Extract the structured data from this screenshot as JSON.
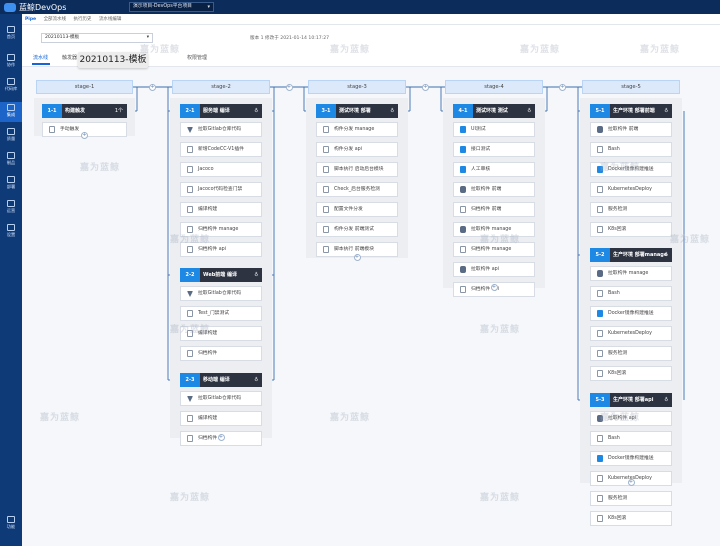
{
  "app": {
    "name": "蓝鲸DevOps",
    "project": "演示项目-DevOps平台项目"
  },
  "sidebar": [
    {
      "label": "首页",
      "icon": "home-icon"
    },
    {
      "label": "协作",
      "icon": "collab-icon"
    },
    {
      "label": "代码库",
      "icon": "code-icon"
    },
    {
      "label": "集成",
      "icon": "integration-icon"
    },
    {
      "label": "质量",
      "icon": "quality-icon"
    },
    {
      "label": "制品",
      "icon": "artifact-icon"
    },
    {
      "label": "部署",
      "icon": "deploy-icon"
    },
    {
      "label": "运营",
      "icon": "ops-icon"
    },
    {
      "label": "设置",
      "icon": "settings-icon"
    },
    {
      "label": "功能",
      "icon": "function-icon"
    }
  ],
  "breadcrumb": [
    "Pipe",
    "全部流水线",
    "执行历史",
    "流水线编辑"
  ],
  "pipeline": {
    "select_value": "20210113-模板",
    "version": "版本 1 修改于 2021-01-14 10:17:27",
    "tooltip": "20210113-模板",
    "tabs": [
      "流水线",
      "触发器",
      "通知设置",
      "权限管理"
    ]
  },
  "stages": [
    {
      "name": "stage-1",
      "jobs": [
        {
          "num": "1-1",
          "name": "构建触发",
          "extra": "1个",
          "tasks": [
            {
              "name": "手动触发",
              "icon": "hand"
            }
          ]
        }
      ]
    },
    {
      "name": "stage-2",
      "jobs": [
        {
          "num": "2-1",
          "name": "服务端 编译",
          "tasks": [
            {
              "name": "拉取Gitlab仓库代码",
              "icon": "tri"
            },
            {
              "name": "新增CodeCC-V1插件",
              "icon": "doc"
            },
            {
              "name": "Jacoco",
              "icon": "doc"
            },
            {
              "name": "Jacoco代码检查门禁",
              "icon": "doc"
            },
            {
              "name": "编译构建",
              "icon": "doc"
            },
            {
              "name": "归档构件 manage",
              "icon": "doc"
            },
            {
              "name": "归档构件 api",
              "icon": "doc"
            }
          ]
        },
        {
          "num": "2-2",
          "name": "Web前端 编译",
          "tasks": [
            {
              "name": "拉取Gitlab仓库代码",
              "icon": "tri"
            },
            {
              "name": "Test_门禁测试",
              "icon": "doc"
            },
            {
              "name": "编译构建",
              "icon": "doc"
            },
            {
              "name": "归档构件",
              "icon": "doc"
            }
          ]
        },
        {
          "num": "2-3",
          "name": "移动端 编译",
          "tasks": [
            {
              "name": "拉取Gitlab仓库代码",
              "icon": "tri"
            },
            {
              "name": "编译构建",
              "icon": "doc"
            },
            {
              "name": "归档构件",
              "icon": "doc"
            }
          ]
        }
      ]
    },
    {
      "name": "stage-3",
      "jobs": [
        {
          "num": "3-1",
          "name": "测试环境 部署",
          "tasks": [
            {
              "name": "构件分发 manage",
              "icon": "doc"
            },
            {
              "name": "构件分发 api",
              "icon": "doc"
            },
            {
              "name": "脚本执行 启动后台模块",
              "icon": "doc"
            },
            {
              "name": "Check_后台服务检测",
              "icon": "doc"
            },
            {
              "name": "配置文件分发",
              "icon": "doc"
            },
            {
              "name": "构件分发 前端测试",
              "icon": "doc"
            },
            {
              "name": "脚本执行 前端模块",
              "icon": "doc"
            }
          ]
        }
      ]
    },
    {
      "name": "stage-4",
      "jobs": [
        {
          "num": "4-1",
          "name": "测试环境 测试",
          "tasks": [
            {
              "name": "UI测试",
              "icon": "img"
            },
            {
              "name": "接口测试",
              "icon": "img"
            },
            {
              "name": "人工审核",
              "icon": "img"
            },
            {
              "name": "拉取构件 前端",
              "icon": "dk"
            },
            {
              "name": "归档构件 前端",
              "icon": "doc"
            },
            {
              "name": "拉取构件 manage",
              "icon": "dk"
            },
            {
              "name": "归档构件 manage",
              "icon": "doc"
            },
            {
              "name": "拉取构件 api",
              "icon": "dk"
            },
            {
              "name": "归档构件 api",
              "icon": "doc"
            }
          ]
        }
      ]
    },
    {
      "name": "stage-5",
      "jobs": [
        {
          "num": "5-1",
          "name": "生产环境 部署前端",
          "tasks": [
            {
              "name": "拉取构件 前端",
              "icon": "dk"
            },
            {
              "name": "Bash",
              "icon": "doc"
            },
            {
              "name": "Docker镜像构建推送",
              "icon": "img"
            },
            {
              "name": "KubernetesDeploy",
              "icon": "doc"
            },
            {
              "name": "服务检测",
              "icon": "doc"
            },
            {
              "name": "K8s回滚",
              "icon": "doc"
            }
          ]
        },
        {
          "num": "5-2",
          "name": "生产环境 部署manage",
          "tasks": [
            {
              "name": "拉取构件 manage",
              "icon": "dk"
            },
            {
              "name": "Bash",
              "icon": "doc"
            },
            {
              "name": "Docker镜像构建推送",
              "icon": "img"
            },
            {
              "name": "KubernetesDeploy",
              "icon": "doc"
            },
            {
              "name": "服务检测",
              "icon": "doc"
            },
            {
              "name": "K8s回滚",
              "icon": "doc"
            }
          ]
        },
        {
          "num": "5-3",
          "name": "生产环境 部署api",
          "tasks": [
            {
              "name": "拉取构件 api",
              "icon": "dk"
            },
            {
              "name": "Bash",
              "icon": "doc"
            },
            {
              "name": "Docker镜像构建推送",
              "icon": "img"
            },
            {
              "name": "KubernetesDeploy",
              "icon": "doc"
            },
            {
              "name": "服务检测",
              "icon": "doc"
            },
            {
              "name": "K8s回滚",
              "icon": "doc"
            }
          ]
        }
      ]
    }
  ],
  "watermark": "嘉为蓝鲸"
}
